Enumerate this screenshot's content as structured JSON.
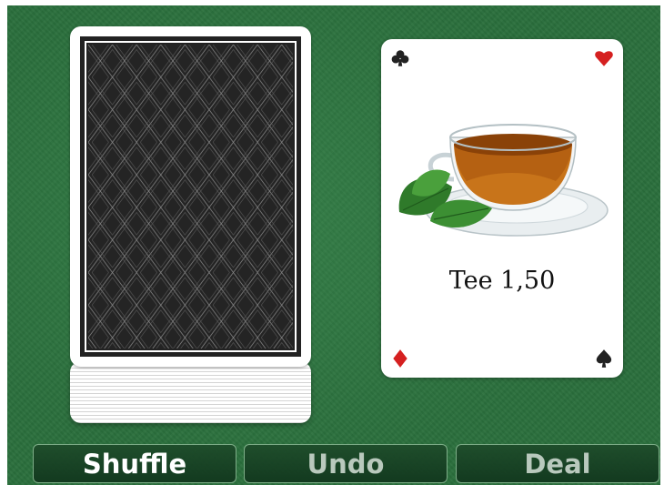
{
  "card": {
    "caption": "Tee 1,50",
    "image_icon": "tea-cup-icon",
    "pips": [
      "club-icon",
      "heart-icon",
      "diamond-icon",
      "spade-icon"
    ],
    "suit_colors": {
      "red": "#d52020",
      "black": "#222222"
    }
  },
  "buttons": {
    "shuffle_label": "Shuffle",
    "undo_label": "Undo",
    "deal_label": "Deal"
  },
  "colors": {
    "felt": "#2a6f3c",
    "button_bg": "#1e4b2a",
    "card_back": "#222222"
  }
}
